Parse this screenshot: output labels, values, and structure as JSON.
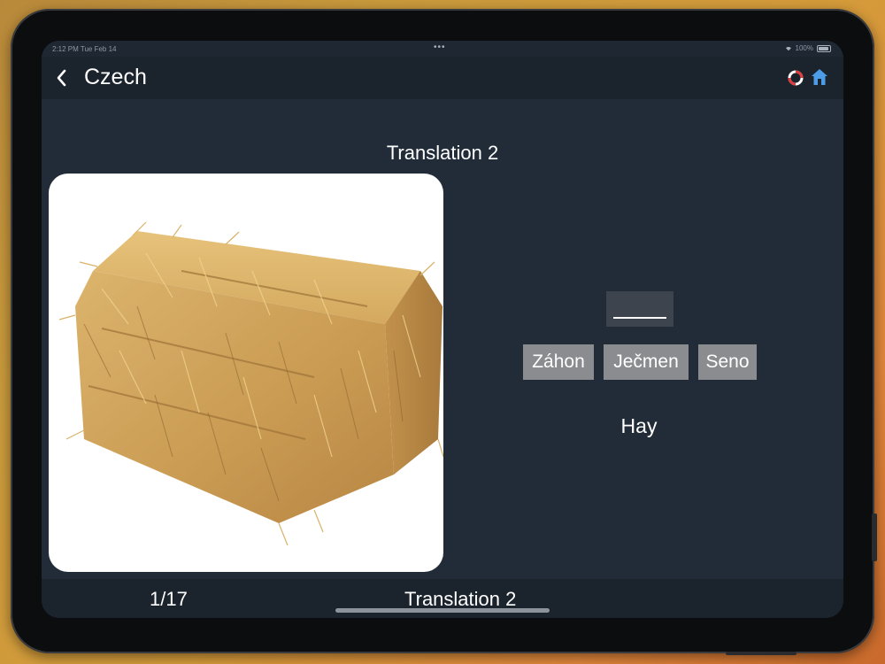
{
  "status_bar": {
    "time": "2:12 PM  Tue Feb 14",
    "battery": "100%"
  },
  "nav": {
    "back_icon": "chevron-left-icon",
    "title": "Czech",
    "help_icon": "lifebuoy-icon",
    "home_icon": "house-icon"
  },
  "exercise": {
    "header": "Translation 2",
    "image": "hay-bale",
    "blank": "____",
    "choices": [
      "Záhon",
      "Ječmen",
      "Seno"
    ],
    "english_word": "Hay"
  },
  "footer": {
    "page_counter": "1/17",
    "label": "Translation 2"
  },
  "colors": {
    "background": "#222c38",
    "nav": "#1b232d",
    "choice": "#8a8c90",
    "home_icon": "#4d9ce8",
    "help_icon": "#e03c3c"
  }
}
